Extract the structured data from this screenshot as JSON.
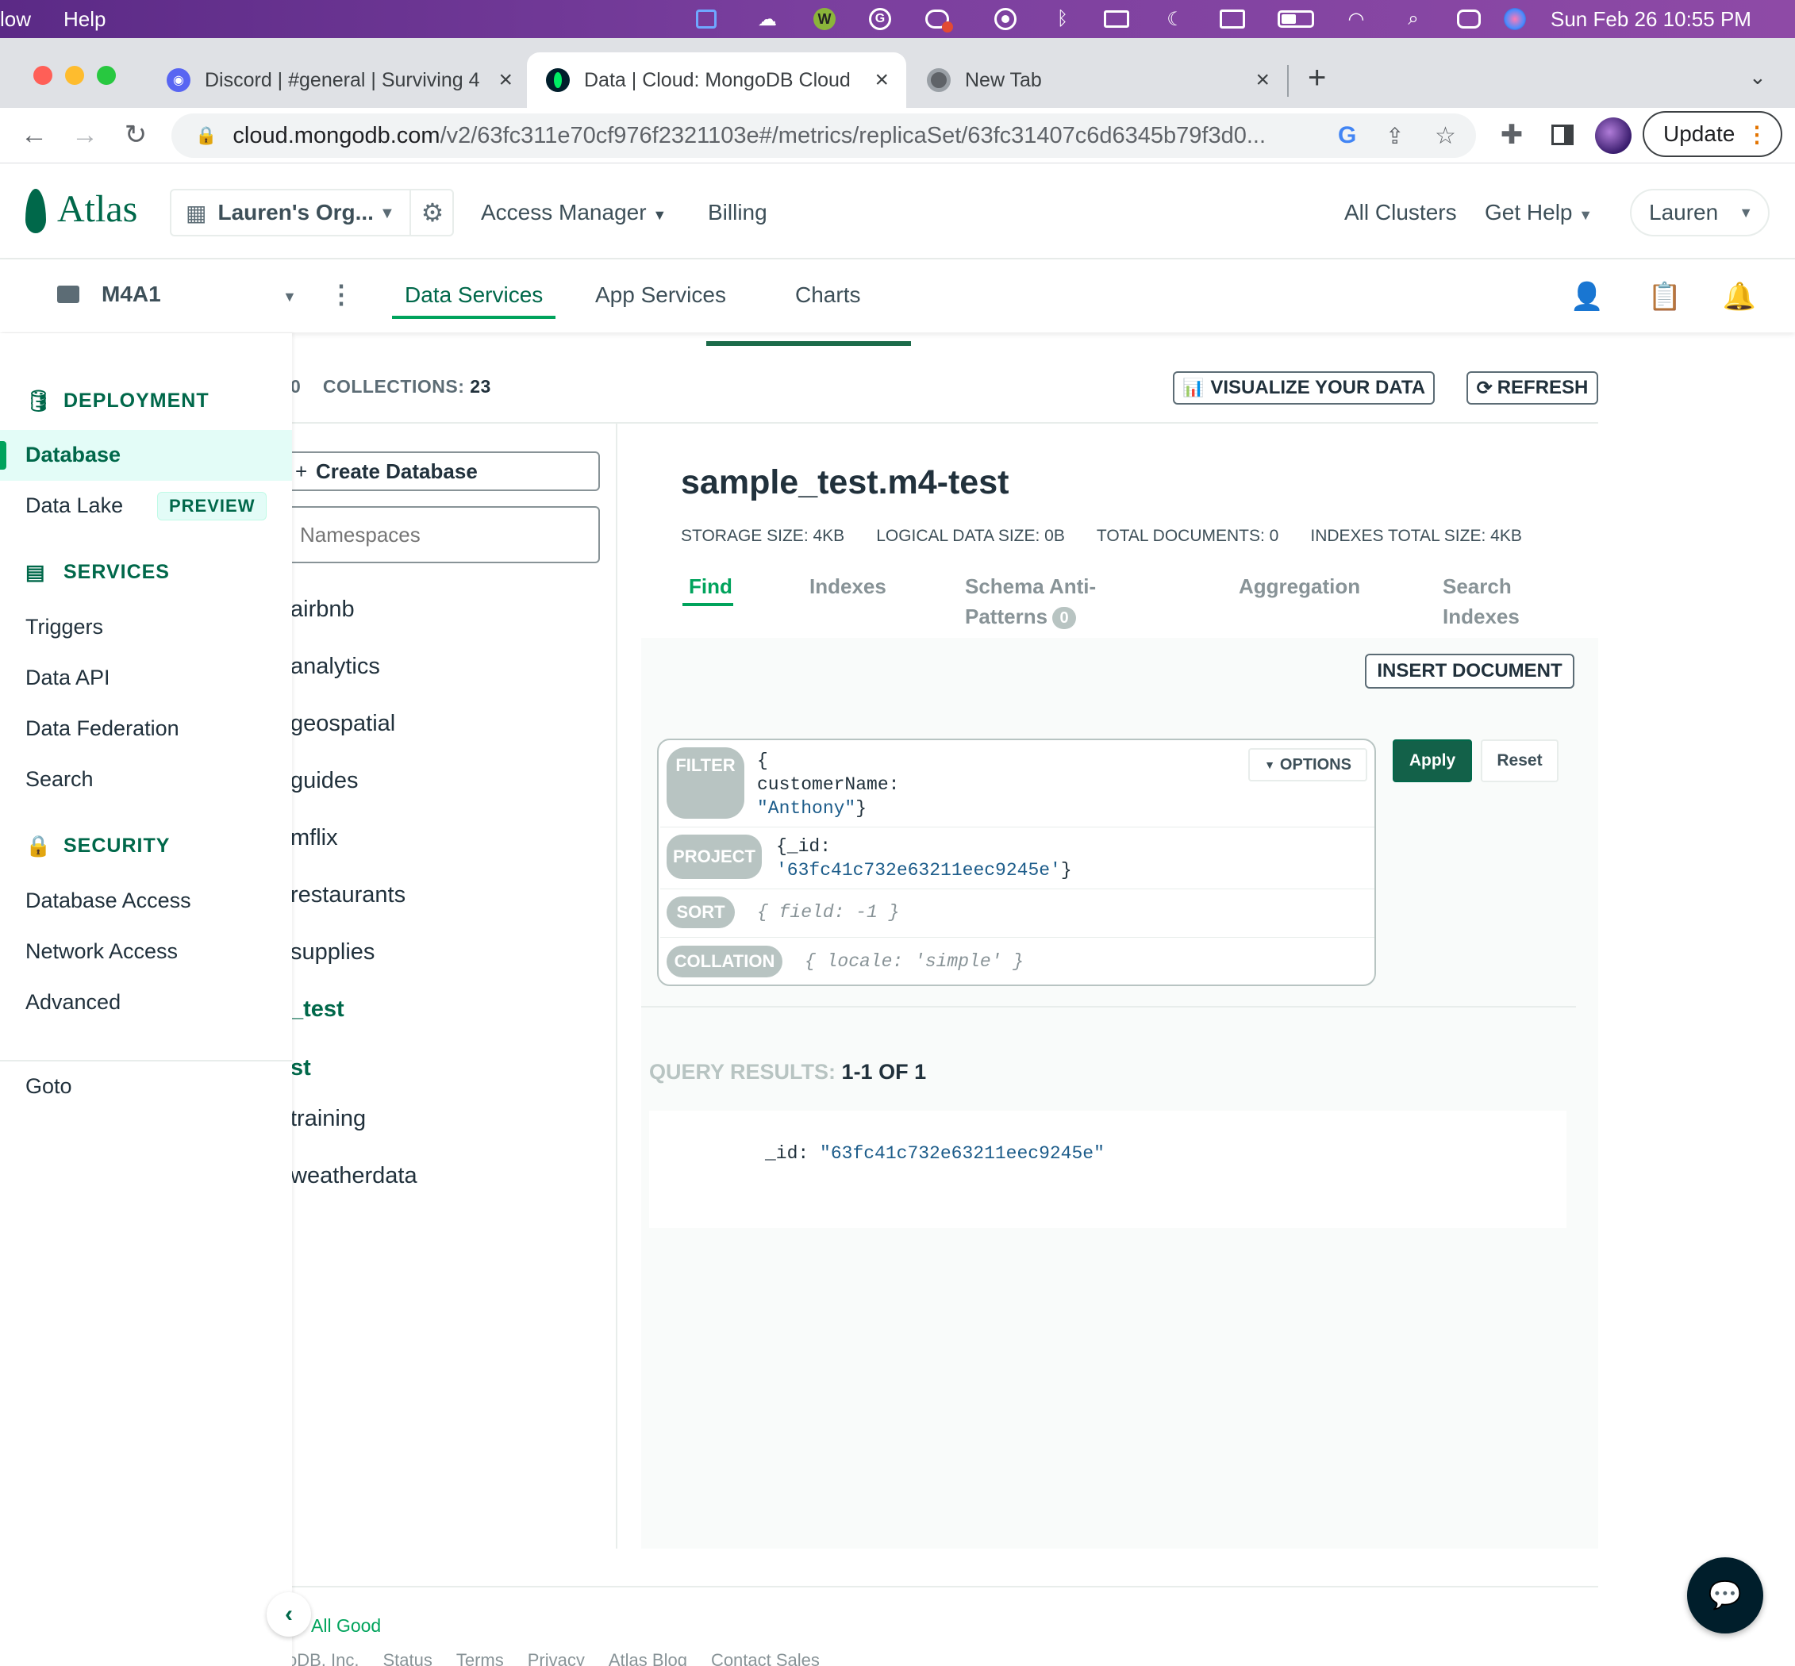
{
  "menubar": {
    "left_items": [
      "low",
      "Help"
    ],
    "datetime": "Sun Feb 26  10:55 PM",
    "status_icons": [
      "screen-share-icon",
      "cloud-icon",
      "grammarly-w-icon",
      "grammarly-g-icon",
      "creative-cloud-icon",
      "record-icon",
      "bluetooth-icon",
      "display-icon",
      "moon-icon",
      "keyboard-icon",
      "battery-icon",
      "wifi-icon",
      "spotlight-icon",
      "control-center-icon",
      "siri-icon"
    ]
  },
  "browser": {
    "tabs": [
      {
        "title": "Discord | #general | Surviving 4",
        "favicon": "discord-icon",
        "active": false
      },
      {
        "title": "Data | Cloud: MongoDB Cloud",
        "favicon": "mongodb-leaf-icon",
        "active": true
      },
      {
        "title": "New Tab",
        "favicon": "chrome-icon",
        "active": false
      }
    ],
    "url_host": "cloud.mongodb.com",
    "url_path": "/v2/63fc311e70cf976f2321103e#/metrics/replicaSet/63fc31407c6d6345b79f3d0...",
    "update_label": "Update"
  },
  "header": {
    "logo": "Atlas",
    "org_name": "Lauren's Org...",
    "access_manager": "Access Manager",
    "billing": "Billing",
    "all_clusters": "All Clusters",
    "get_help": "Get Help",
    "user": "Lauren"
  },
  "project": {
    "name": "M4A1",
    "tabs": [
      "Data Services",
      "App Services",
      "Charts"
    ]
  },
  "sidebar": {
    "deployment_heading": "DEPLOYMENT",
    "database": "Database",
    "data_lake": "Data Lake",
    "preview_badge": "PREVIEW",
    "services_heading": "SERVICES",
    "services": [
      "Triggers",
      "Data API",
      "Data Federation",
      "Search"
    ],
    "security_heading": "SECURITY",
    "security": [
      "Database Access",
      "Network Access",
      "Advanced"
    ],
    "goto": "Goto"
  },
  "explorer": {
    "count_prefix": "0",
    "collections_label": "COLLECTIONS:",
    "collections_count": "23",
    "visualize_label": "VISUALIZE YOUR DATA",
    "refresh_label": "REFRESH",
    "create_db_label": "Create Database",
    "namespaces_placeholder": "Namespaces",
    "databases": [
      "airbnb",
      "analytics",
      "geospatial",
      "guides",
      "mflix",
      "restaurants",
      "supplies",
      "_test",
      "st",
      "training",
      "weatherdata"
    ],
    "selected_database": "_test",
    "selected_collection": "st"
  },
  "collection": {
    "title": "sample_test.m4-test",
    "storage_size": "STORAGE SIZE: 4KB",
    "logical_size": "LOGICAL DATA SIZE: 0B",
    "total_docs": "TOTAL DOCUMENTS: 0",
    "indexes_size": "INDEXES TOTAL SIZE: 4KB",
    "tabs": {
      "find": "Find",
      "indexes": "Indexes",
      "schema_line1": "Schema Anti-",
      "schema_line2": "Patterns",
      "schema_count": "0",
      "aggregation": "Aggregation",
      "search_line1": "Search",
      "search_line2": "Indexes"
    },
    "insert_label": "INSERT DOCUMENT"
  },
  "query": {
    "filter_label": "FILTER",
    "filter_line1": "{",
    "filter_line2": "customerName:",
    "filter_value": "\"Anthony\"",
    "filter_close": "}",
    "project_label": "PROJECT",
    "project_line1": "{_id:",
    "project_value": "'63fc41c732e63211eec9245e'",
    "project_close": "}",
    "sort_label": "SORT",
    "sort_placeholder": "{ field: -1 }",
    "collation_label": "COLLATION",
    "collation_placeholder": "{ locale: 'simple' }",
    "options_label": "OPTIONS",
    "apply_label": "Apply",
    "reset_label": "Reset"
  },
  "results": {
    "label": "QUERY RESULTS:",
    "range": "1-1 OF 1",
    "doc_key": "_id:",
    "doc_value": "\"63fc41c732e63211eec9245e\""
  },
  "footer": {
    "status": "All Good",
    "links": [
      "oDB, Inc.",
      "Status",
      "Terms",
      "Privacy",
      "Atlas Blog",
      "Contact Sales"
    ]
  },
  "colors": {
    "brand_green": "#00684a",
    "accent_green": "#00a35c",
    "apply_green": "#136149"
  }
}
